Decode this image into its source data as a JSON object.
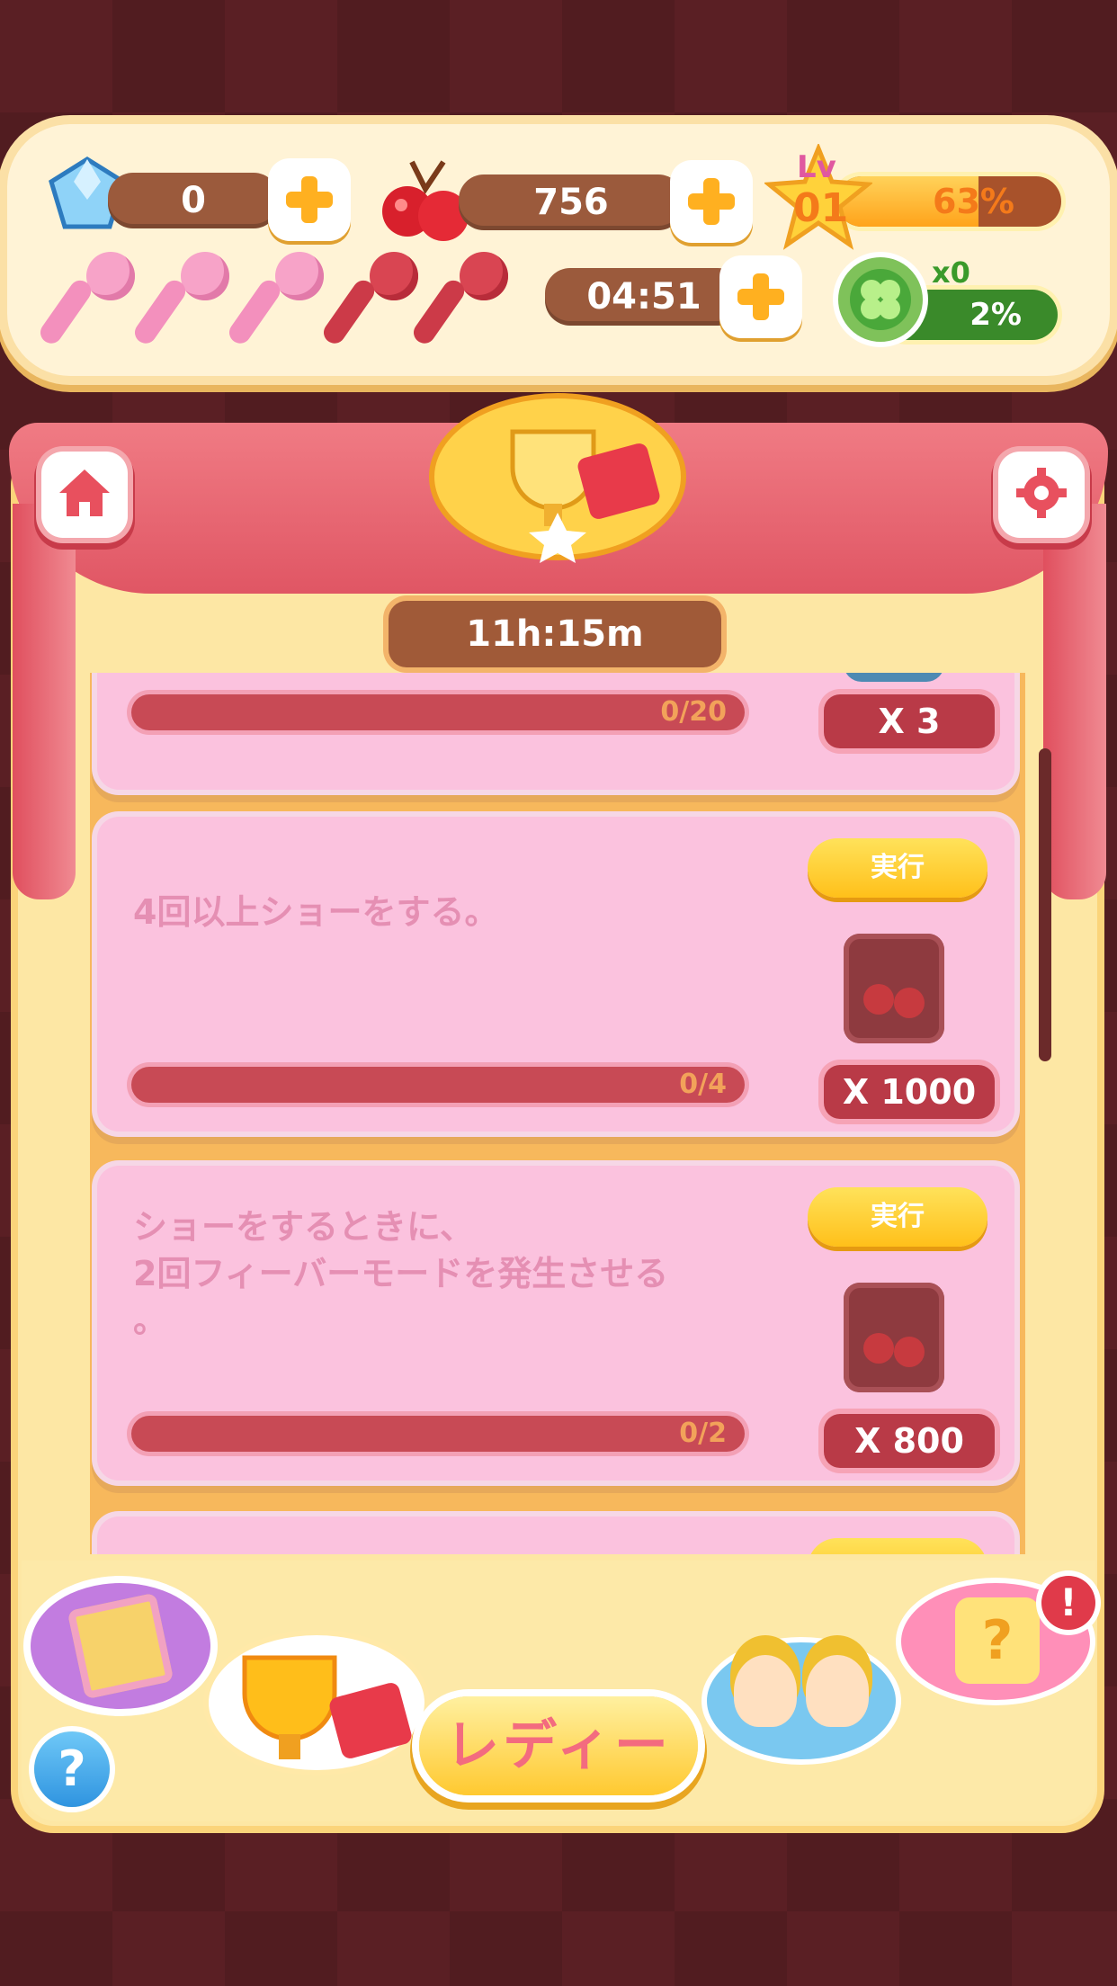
{
  "header": {
    "gems": "0",
    "cherries": "756",
    "level_label": "Lv",
    "level": "01",
    "level_progress": "63%",
    "level_progress_value": 63,
    "mic_timer": "04:51",
    "clover_count": "x0",
    "clover_progress": "2%",
    "clover_progress_value": 2,
    "mics_total": 5,
    "mics_full": 3
  },
  "event": {
    "timer": "11h:15m"
  },
  "missions": [
    {
      "description": "",
      "progress": "0/20",
      "progress_value": 0,
      "reward": "X 3",
      "button": ""
    },
    {
      "description": "4回以上ショーをする。",
      "progress": "0/4",
      "progress_value": 0,
      "reward": "X 1000",
      "button": "実行"
    },
    {
      "description": "ショーをするときに、\n2回フィーバーモードを発生させる\n。",
      "progress": "0/2",
      "progress_value": 0,
      "reward": "X 800",
      "button": "実行"
    }
  ],
  "bottom": {
    "ready_label": "レディー",
    "help_label": "?",
    "alert_label": "!"
  },
  "colors": {
    "stage_curtain": "#e05664",
    "card_pink": "#fbc2de",
    "button_yellow": "#ffc01a",
    "progress_red": "#c84a55"
  }
}
